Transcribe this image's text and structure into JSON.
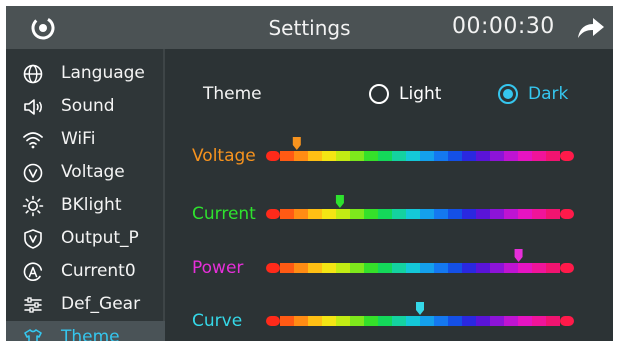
{
  "header": {
    "title": "Settings",
    "timer": "00:00:30",
    "logo_icon": "power-circle-icon",
    "share_icon": "share-arrow-icon"
  },
  "sidebar": {
    "items": [
      {
        "label": "Language",
        "icon": "globe-icon",
        "active": false
      },
      {
        "label": "Sound",
        "icon": "speaker-icon",
        "active": false
      },
      {
        "label": "WiFi",
        "icon": "wifi-icon",
        "active": false
      },
      {
        "label": "Voltage",
        "icon": "voltage-circle-icon",
        "active": false
      },
      {
        "label": "BKlight",
        "icon": "sun-icon",
        "active": false
      },
      {
        "label": "Output_P",
        "icon": "shield-v-icon",
        "active": false
      },
      {
        "label": "Current0",
        "icon": "circle-a-icon",
        "active": false
      },
      {
        "label": "Def_Gear",
        "icon": "sliders-icon",
        "active": false
      },
      {
        "label": "Theme",
        "icon": "tshirt-icon",
        "active": true
      }
    ]
  },
  "theme": {
    "label": "Theme",
    "options": [
      {
        "label": "Light",
        "selected": false
      },
      {
        "label": "Dark",
        "selected": true
      }
    ]
  },
  "color_sliders": [
    {
      "label": "Voltage",
      "color": "#f7931e",
      "position": 0.1
    },
    {
      "label": "Current",
      "color": "#2ee22e",
      "position": 0.24
    },
    {
      "label": "Power",
      "color": "#e62fd9",
      "position": 0.82
    },
    {
      "label": "Curve",
      "color": "#35d8e8",
      "position": 0.5
    }
  ],
  "colors": {
    "accent": "#35c6ee",
    "background": "#2c3335",
    "header": "#4b5254"
  }
}
